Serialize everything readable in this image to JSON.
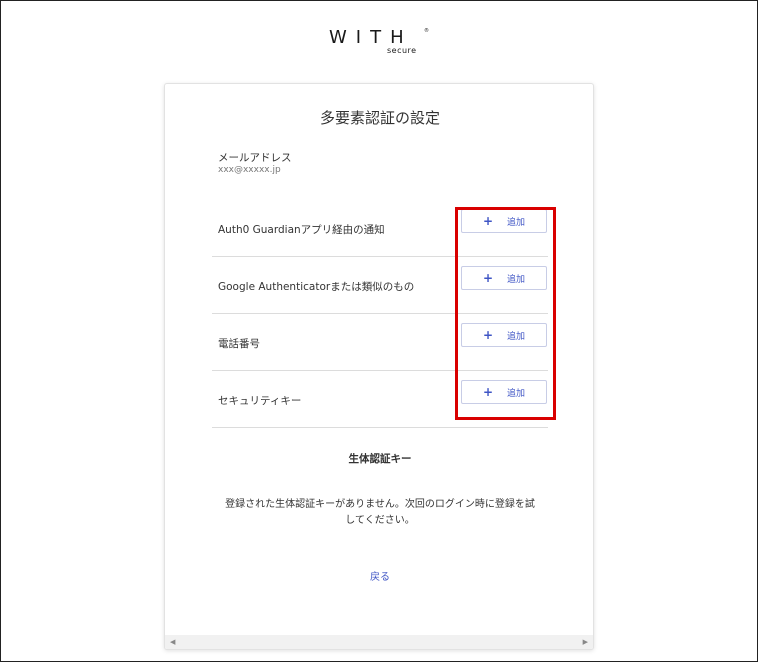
{
  "logo": {
    "main": "WITH",
    "registered": "®",
    "sub": "secure"
  },
  "card": {
    "title": "多要素認証の設定",
    "email_label": "メールアドレス",
    "email_value": "xxx@xxxxx.jp"
  },
  "factors": [
    {
      "label": "Auth0 Guardianアプリ経由の通知",
      "button": "追加"
    },
    {
      "label": "Google Authenticatorまたは類似のもの",
      "button": "追加"
    },
    {
      "label": "電話番号",
      "button": "追加"
    },
    {
      "label": "セキュリティキー",
      "button": "追加"
    }
  ],
  "add_icon": "+",
  "biometric": {
    "title": "生体認証キー",
    "message": "登録された生体認証キーがありません。次回のログイン時に登録を試してください。"
  },
  "back_link": "戻る",
  "scrollbar": {
    "left_arrow": "◀",
    "right_arrow": "▶"
  },
  "colors": {
    "accent": "#3f55c5",
    "highlight": "#d90000"
  }
}
